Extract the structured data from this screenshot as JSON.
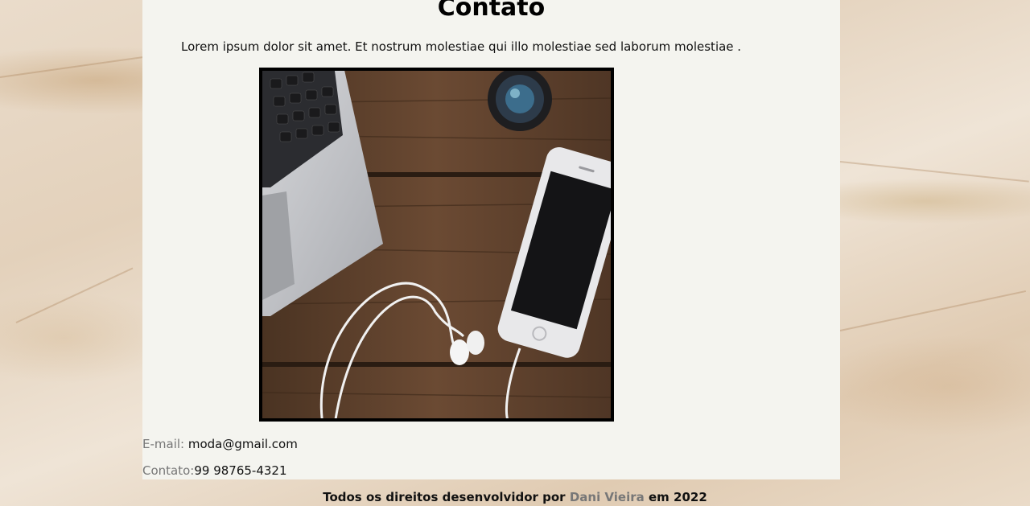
{
  "page": {
    "title": "Contato",
    "intro": "Lorem ipsum dolor sit amet. Et nostrum molestiae qui illo molestiae sed laborum molestiae ."
  },
  "contact": {
    "email_label": "E-mail:",
    "email_value": "moda@gmail.com",
    "phone_label": "Contato:",
    "phone_value": "99 98765-4321"
  },
  "footer": {
    "prefix": "Todos os direitos desenvolvidor por",
    "author": "Dani Vieira",
    "suffix": "em 2022"
  },
  "colors": {
    "panel": "#f4f4ef",
    "muted_label": "#777777"
  }
}
